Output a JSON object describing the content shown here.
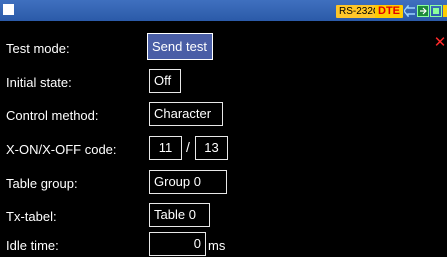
{
  "statusbar": {
    "port": "RS-232C",
    "mode": "DTE"
  },
  "rows": [
    {
      "label": "Test mode:",
      "value": "Send test"
    },
    {
      "label": "Initial state:",
      "value": "Off"
    },
    {
      "label": "Control method:",
      "value": "Character"
    },
    {
      "label": "X-ON/X-OFF code:",
      "value_on": "11",
      "separator": "/",
      "value_off": "13"
    },
    {
      "label": "Table group:",
      "value": "Group 0"
    },
    {
      "label": "Tx-tabel:",
      "value": "Table 0"
    },
    {
      "label": "Idle time:",
      "value": "0",
      "unit": "ms"
    }
  ],
  "icons": {
    "close": "close-icon",
    "arrow": "arrow-left-icon",
    "keyboard": "keyboard-icon",
    "screen": "screen-icon",
    "power": "power-icon"
  },
  "colors": {
    "titlebar": "#2b5aa8",
    "selected_field": "#4a5ea6",
    "close": "#ff2a2a",
    "badge_rs": "#ffc629",
    "badge_dte_text": "#e00000"
  }
}
